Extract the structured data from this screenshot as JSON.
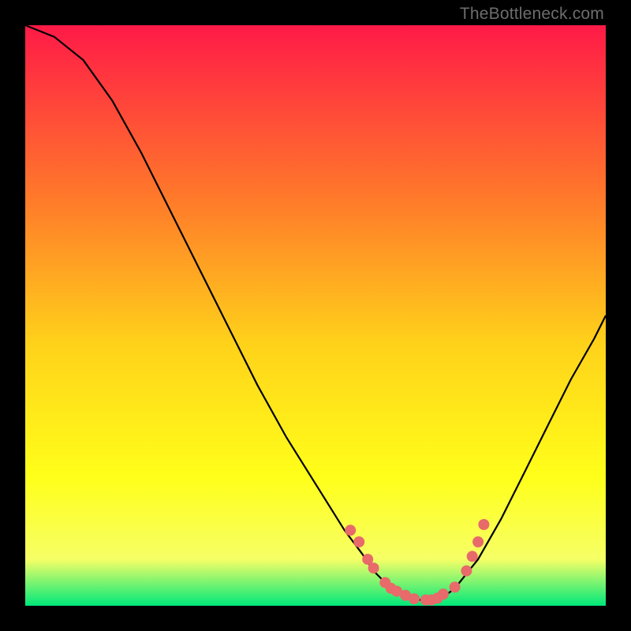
{
  "watermark": "TheBottleneck.com",
  "colors": {
    "frame": "#000000",
    "grad_top": "#ff1a47",
    "grad_mid1": "#ff7a2a",
    "grad_mid2": "#ffd21a",
    "grad_mid3": "#ffff1a",
    "grad_mid4": "#f6ff66",
    "grad_bottom": "#00e87a",
    "line": "#000000",
    "dot": "#e86a6a"
  },
  "chart_data": {
    "type": "line",
    "title": "",
    "xlabel": "",
    "ylabel": "",
    "xlim": [
      0,
      100
    ],
    "ylim": [
      0,
      100
    ],
    "curve": {
      "x": [
        0,
        5,
        10,
        15,
        20,
        25,
        30,
        35,
        40,
        45,
        50,
        55,
        58,
        60,
        62,
        64,
        66,
        68,
        70,
        72,
        74,
        78,
        82,
        86,
        90,
        94,
        98,
        100
      ],
      "y": [
        100,
        98,
        94,
        87,
        78,
        68,
        58,
        48,
        38,
        29,
        21,
        13,
        9,
        6,
        4,
        2.5,
        1.5,
        1,
        1,
        1.5,
        3,
        8,
        15,
        23,
        31,
        39,
        46,
        50
      ]
    },
    "dots": {
      "x": [
        56,
        57.5,
        59,
        60,
        62,
        63,
        64,
        65.5,
        67,
        69,
        70,
        71,
        72,
        74,
        76,
        77,
        78,
        79
      ],
      "y": [
        13,
        11,
        8,
        6.5,
        4,
        3,
        2.5,
        1.8,
        1.2,
        1,
        1,
        1.3,
        2,
        3.2,
        6,
        8.5,
        11,
        14
      ]
    }
  }
}
